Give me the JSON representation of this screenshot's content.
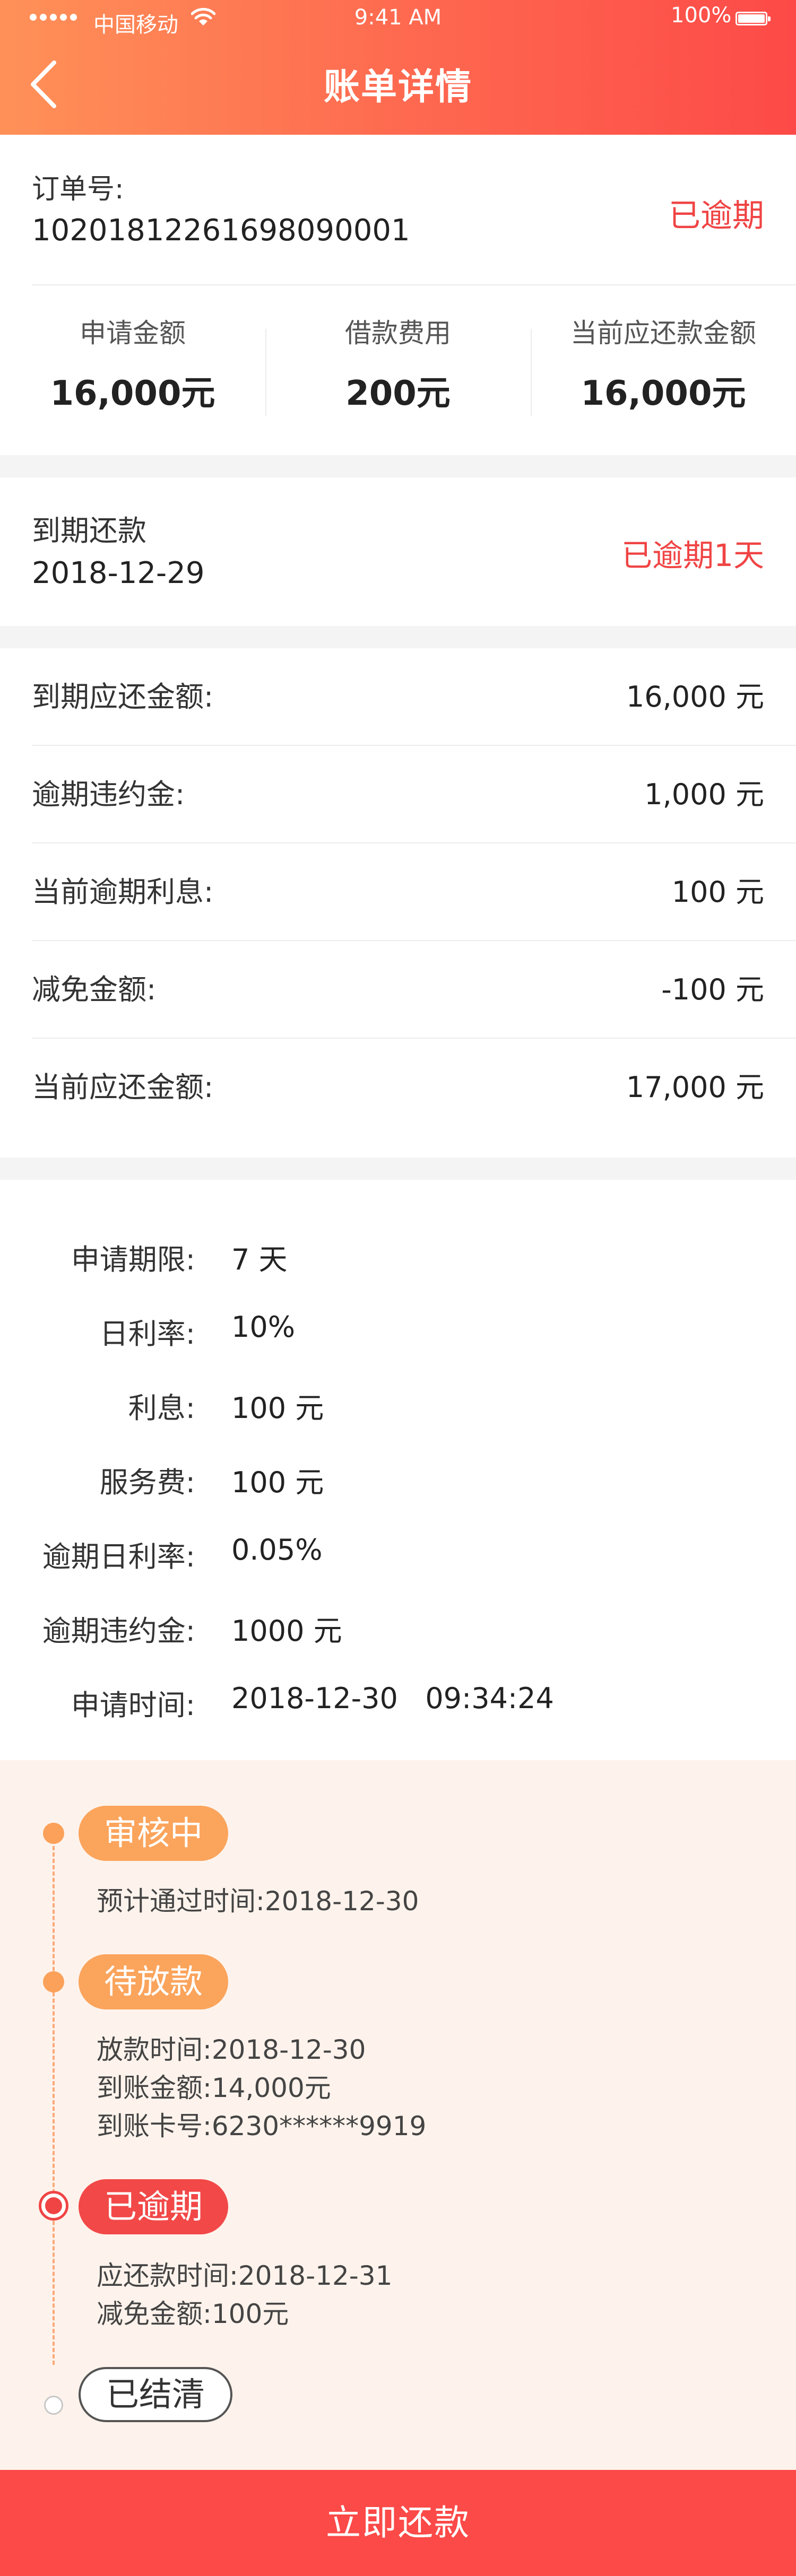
{
  "status_bar": {
    "carrier": "中国移动",
    "time": "9:41 AM",
    "battery": "100%"
  },
  "header": {
    "title": "账单详情"
  },
  "order": {
    "label": "订单号:",
    "number": "10201812261698090001",
    "status": "已逾期",
    "summary": [
      {
        "label": "申请金额",
        "value": "16,000元"
      },
      {
        "label": "借款费用",
        "value": "200元"
      },
      {
        "label": "当前应还款金额",
        "value": "16,000元"
      }
    ]
  },
  "due": {
    "label": "到期还款",
    "date": "2018-12-29",
    "status": "已逾期1天"
  },
  "amounts": [
    {
      "label": "到期应还金额:",
      "value": "16,000 元"
    },
    {
      "label": "逾期违约金:",
      "value": "1,000 元"
    },
    {
      "label": "当前逾期利息:",
      "value": "100 元"
    },
    {
      "label": "减免金额:",
      "value": "-100 元"
    },
    {
      "label": "当前应还金额:",
      "value": "17,000 元"
    }
  ],
  "details": [
    {
      "label": "申请期限:",
      "value": "7 天"
    },
    {
      "label": "日利率:",
      "value": "10%"
    },
    {
      "label": "利息:",
      "value": "100 元"
    },
    {
      "label": "服务费:",
      "value": "100 元"
    },
    {
      "label": "逾期日利率:",
      "value": "0.05%"
    },
    {
      "label": "逾期违约金:",
      "value": "1000 元"
    },
    {
      "label": "申请时间:",
      "value": "2018-12-30   09:34:24"
    }
  ],
  "timeline": [
    {
      "status": "审核中",
      "lines": [
        "预计通过时间:2018-12-30"
      ]
    },
    {
      "status": "待放款",
      "lines": [
        "放款时间:2018-12-30",
        "到账金额:14,000元",
        "到账卡号:6230******9919"
      ]
    },
    {
      "status": "已逾期",
      "lines": [
        "应还款时间:2018-12-31",
        "减免金额:100元"
      ]
    },
    {
      "status": "已结清",
      "lines": []
    }
  ],
  "actions": {
    "pay_label": "立即还款"
  },
  "colors": {
    "brand_start": "#ff9158",
    "brand_end": "#fd4a48",
    "overdue": "#f04444",
    "pending": "#fba45c"
  }
}
